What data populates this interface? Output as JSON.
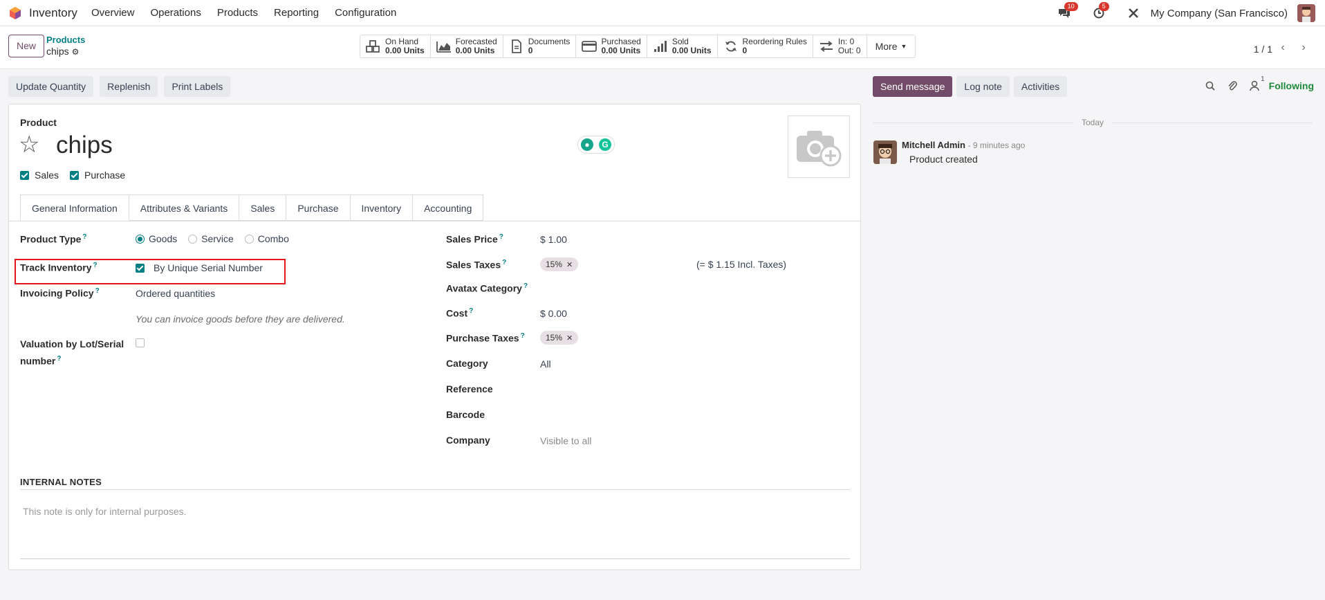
{
  "topnav": {
    "app_name": "Inventory",
    "menu": [
      "Overview",
      "Operations",
      "Products",
      "Reporting",
      "Configuration"
    ],
    "messages_badge": "10",
    "activities_badge": "5",
    "company": "My Company (San Francisco)"
  },
  "control": {
    "new_label": "New",
    "breadcrumb_parent": "Products",
    "breadcrumb_current": "chips",
    "stats": [
      {
        "label": "On Hand",
        "value": "0.00 Units",
        "icon": "cubes-icon"
      },
      {
        "label": "Forecasted",
        "value": "0.00 Units",
        "icon": "area-chart-icon"
      },
      {
        "label": "Documents",
        "value": "0",
        "icon": "file-icon"
      },
      {
        "label": "Purchased",
        "value": "0.00 Units",
        "icon": "credit-card-icon"
      },
      {
        "label": "Sold",
        "value": "0.00 Units",
        "icon": "signal-icon"
      },
      {
        "label": "Reordering Rules",
        "value": "0",
        "icon": "refresh-icon"
      },
      {
        "label": "In: 0",
        "value": "Out: 0",
        "icon": "exchange-icon"
      }
    ],
    "more_label": "More",
    "pager": "1 / 1"
  },
  "actions": [
    "Update Quantity",
    "Replenish",
    "Print Labels"
  ],
  "form": {
    "product_label": "Product",
    "name": "chips",
    "sales_label": "Sales",
    "purchase_label": "Purchase",
    "tabs": [
      "General Information",
      "Attributes & Variants",
      "Sales",
      "Purchase",
      "Inventory",
      "Accounting"
    ],
    "left": {
      "product_type_label": "Product Type",
      "product_type_options": [
        "Goods",
        "Service",
        "Combo"
      ],
      "product_type_selected": "Goods",
      "track_inventory_label": "Track Inventory",
      "track_inventory_value": "By Unique Serial Number",
      "invoicing_policy_label": "Invoicing Policy",
      "invoicing_policy_value": "Ordered quantities",
      "invoicing_hint": "You can invoice goods before they are delivered.",
      "valuation_label_1": "Valuation by Lot/Serial",
      "valuation_label_2": "number"
    },
    "right": {
      "sales_price_label": "Sales Price",
      "sales_price": "$ 1.00",
      "sales_taxes_label": "Sales Taxes",
      "sales_tax_tag": "15%",
      "incl_taxes": "(= $ 1.15 Incl. Taxes)",
      "avatax_label": "Avatax Category",
      "cost_label": "Cost",
      "cost": "$ 0.00",
      "purchase_taxes_label": "Purchase Taxes",
      "purchase_tax_tag": "15%",
      "category_label": "Category",
      "category": "All",
      "reference_label": "Reference",
      "barcode_label": "Barcode",
      "company_label": "Company",
      "company_placeholder": "Visible to all"
    },
    "internal_notes_label": "INTERNAL NOTES",
    "internal_notes_placeholder": "This note is only for internal purposes."
  },
  "chatter": {
    "send_message": "Send message",
    "log_note": "Log note",
    "activities": "Activities",
    "followers_count": "1",
    "following": "Following",
    "today": "Today",
    "author": "Mitchell Admin",
    "time": "- 9 minutes ago",
    "body": "Product created"
  },
  "colors": {
    "brand": "#714b67",
    "accent": "#017e84",
    "highlight": "#e3141a",
    "following": "#1f8a3c"
  }
}
